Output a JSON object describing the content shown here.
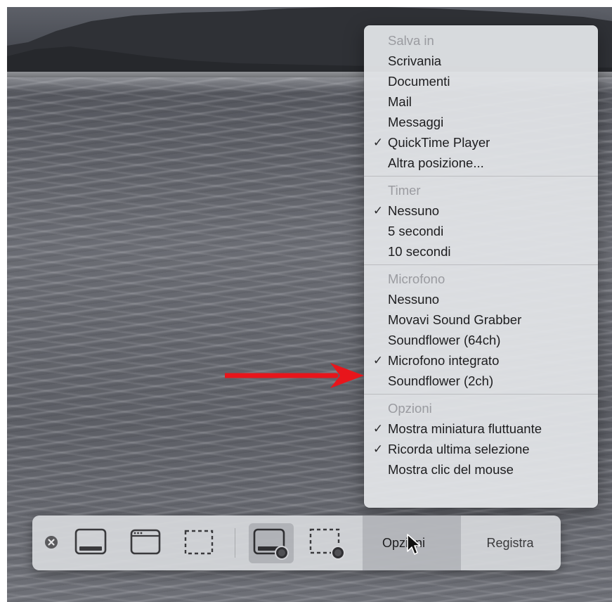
{
  "menu": {
    "sections": [
      {
        "header": "Salva in",
        "items": [
          {
            "label": "Scrivania",
            "checked": false
          },
          {
            "label": "Documenti",
            "checked": false
          },
          {
            "label": "Mail",
            "checked": false
          },
          {
            "label": "Messaggi",
            "checked": false
          },
          {
            "label": "QuickTime Player",
            "checked": true
          },
          {
            "label": "Altra posizione...",
            "checked": false
          }
        ]
      },
      {
        "header": "Timer",
        "items": [
          {
            "label": "Nessuno",
            "checked": true
          },
          {
            "label": "5 secondi",
            "checked": false
          },
          {
            "label": "10 secondi",
            "checked": false
          }
        ]
      },
      {
        "header": "Microfono",
        "items": [
          {
            "label": "Nessuno",
            "checked": false
          },
          {
            "label": "Movavi Sound Grabber",
            "checked": false
          },
          {
            "label": "Soundflower (64ch)",
            "checked": false
          },
          {
            "label": "Microfono integrato",
            "checked": true
          },
          {
            "label": "Soundflower (2ch)",
            "checked": false
          }
        ]
      },
      {
        "header": "Opzioni",
        "items": [
          {
            "label": "Mostra miniatura fluttuante",
            "checked": true
          },
          {
            "label": "Ricorda ultima selezione",
            "checked": true
          },
          {
            "label": "Mostra clic del mouse",
            "checked": false
          }
        ]
      }
    ],
    "check_glyph": "✓"
  },
  "toolbar": {
    "options_label": "Opzioni",
    "record_label": "Registra",
    "icons": [
      "close-icon",
      "capture-entire-screen-icon",
      "capture-window-icon",
      "capture-selection-icon",
      "record-entire-screen-icon",
      "record-selection-icon"
    ]
  },
  "annotation": {
    "arrow_color": "#e8151b"
  }
}
